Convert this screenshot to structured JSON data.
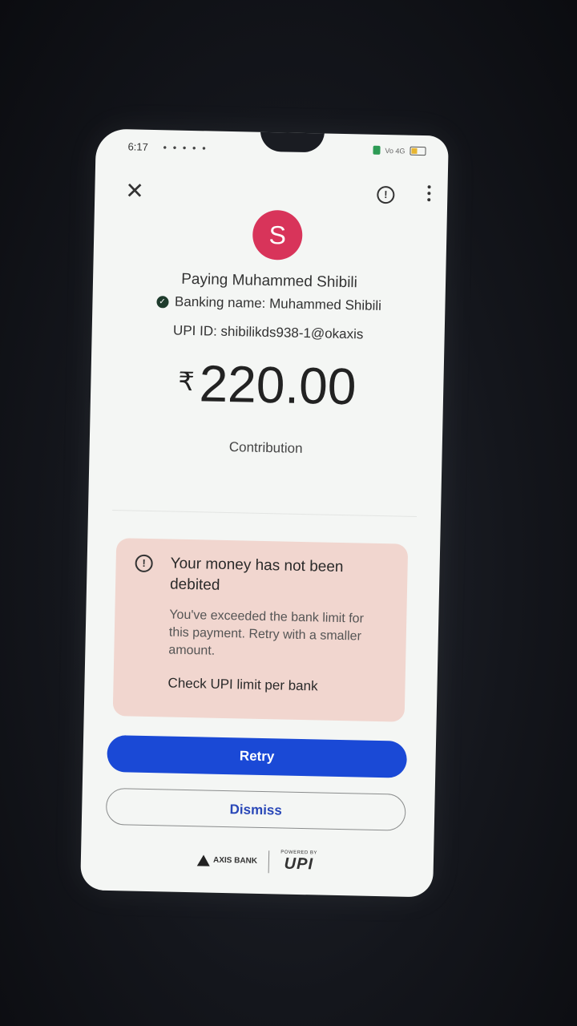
{
  "status_bar": {
    "time": "6:17",
    "notification_icons": "• • • • •",
    "network": "Vo 4G",
    "battery_color": "#e7b531"
  },
  "toolbar": {
    "close_icon": "close-icon",
    "report_icon": "report-icon",
    "menu_icon": "more-vert-icon"
  },
  "payee": {
    "avatar_letter": "S",
    "avatar_color": "#d8345a",
    "paying_text": "Paying Muhammed  Shibili",
    "banking_name": "Banking name: Muhammed  Shibili",
    "upi_id": "UPI ID: shibilikds938-1@okaxis"
  },
  "payment": {
    "currency_symbol": "₹",
    "amount": "220.00",
    "note": "Contribution"
  },
  "alert": {
    "title": "Your money has not been debited",
    "body": "You've exceeded the bank limit for this payment. Retry with a smaller amount.",
    "link": "Check UPI limit per bank",
    "background": "#f1d6cf"
  },
  "actions": {
    "retry_label": "Retry",
    "dismiss_label": "Dismiss",
    "primary_color": "#1a49d6"
  },
  "footer": {
    "bank_label": "AXIS BANK",
    "powered_by": "POWERED BY",
    "upi_label": "UPI"
  }
}
